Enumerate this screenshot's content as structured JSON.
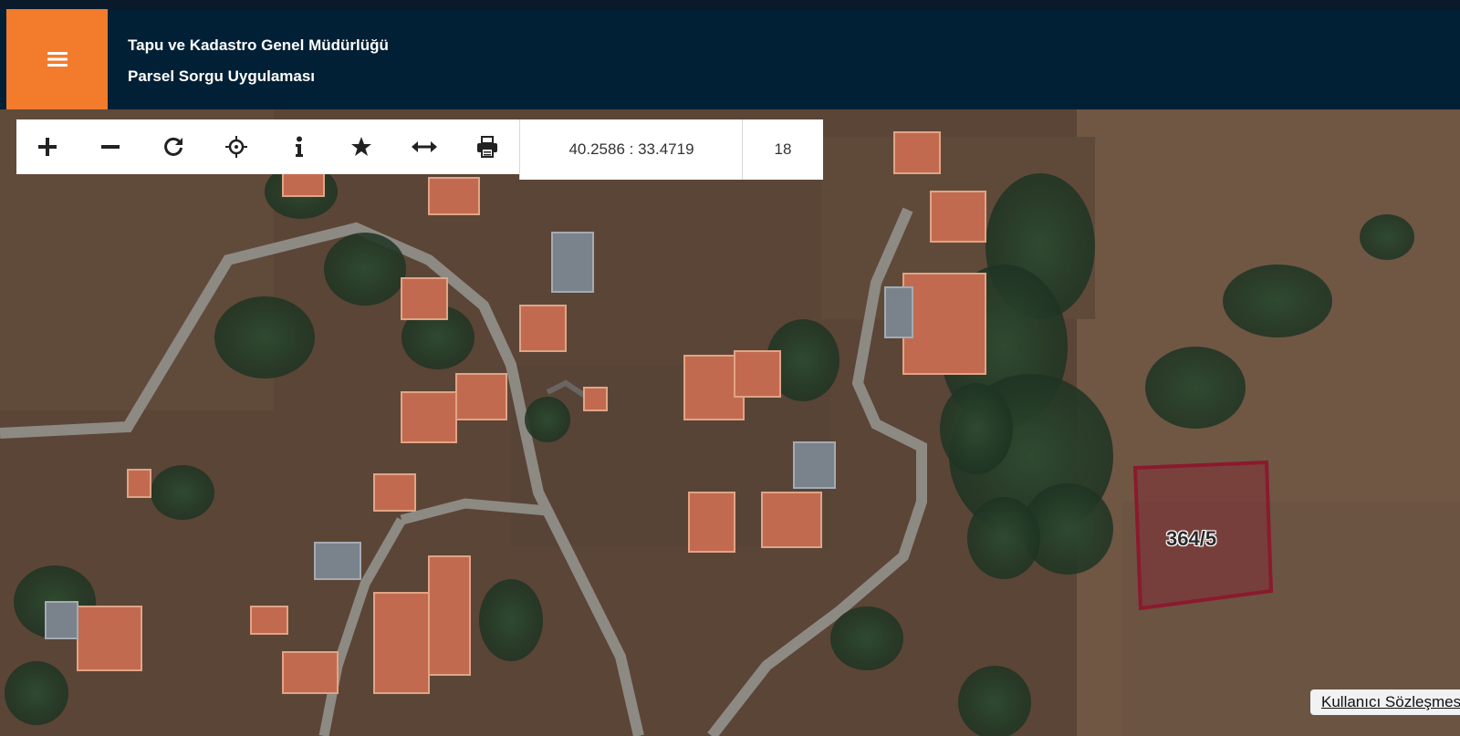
{
  "header": {
    "title": "Tapu ve Kadastro Genel Müdürlüğü",
    "subtitle": "Parsel Sorgu Uygulaması",
    "menu_icon": "hamburger-menu-icon"
  },
  "toolbar": {
    "tools": [
      {
        "name": "zoom-in",
        "icon": "plus-icon"
      },
      {
        "name": "zoom-out",
        "icon": "minus-icon"
      },
      {
        "name": "refresh",
        "icon": "refresh-icon"
      },
      {
        "name": "locate",
        "icon": "crosshair-icon"
      },
      {
        "name": "info",
        "icon": "info-icon"
      },
      {
        "name": "favorites",
        "icon": "star-icon"
      },
      {
        "name": "measure",
        "icon": "arrows-horizontal-icon"
      },
      {
        "name": "print",
        "icon": "print-icon"
      }
    ],
    "coordinates": "40.2586 : 33.4719",
    "zoom_level": "18"
  },
  "map": {
    "parcel_label": "364/5",
    "parcel_color": "#8b1a2e"
  },
  "footer": {
    "terms_link": "Kullanıcı Sözleşmesi"
  },
  "colors": {
    "header_bg": "#022035",
    "menu_button_bg": "#f37b2c"
  }
}
